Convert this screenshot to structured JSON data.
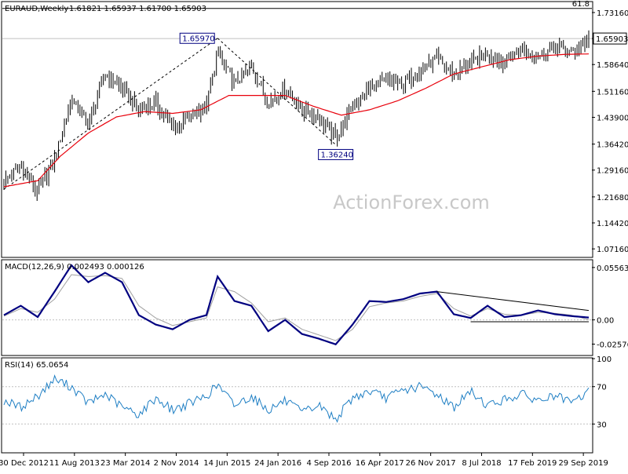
{
  "header": {
    "symbol": "EURAUD,Weekly",
    "ohlc": "1.61821 1.65937 1.61700 1.65903"
  },
  "watermark": "ActionForex.com",
  "colors": {
    "background": "#ffffff",
    "frame": "#000000",
    "grid": "#c0c0c0",
    "candle": "#000000",
    "ma": "#e8000b",
    "macd": "#000080",
    "signal": "#a0a0a0",
    "trend": "#000000",
    "rsi": "#1f7fc4",
    "price_box_bg": "#ffffff",
    "watermark": "#c8c8c8"
  },
  "chart_data": [
    {
      "type": "candlestick",
      "title": "EURAUD,Weekly",
      "ylim": [
        1.05,
        1.76
      ],
      "y_ticks": [
        "1.73160",
        "1.65903",
        "1.58640",
        "1.51160",
        "1.43900",
        "1.36420",
        "1.29160",
        "1.21680",
        "1.14420",
        "1.07160"
      ],
      "x_ticks": [
        "30 Dec 2012",
        "11 Aug 2013",
        "23 Mar 2014",
        "2 Nov 2014",
        "14 Jun 2015",
        "24 Jan 2016",
        "4 Sep 2016",
        "16 Apr 2017",
        "26 Nov 2017",
        "8 Jul 2018",
        "17 Feb 2019",
        "29 Sep 2019"
      ],
      "last_price": "1.65903",
      "fib_label": "61.8",
      "fib_level": 1.743,
      "annotations": [
        {
          "text": "1.65970",
          "date_index": 38,
          "value": 1.6597
        },
        {
          "text": "1.36240",
          "date_index": 59,
          "value": 1.3624
        }
      ],
      "dashed_lines": [
        {
          "from": [
            0,
            1.238
          ],
          "to": [
            38,
            1.6597
          ]
        },
        {
          "from": [
            38,
            1.6597
          ],
          "to": [
            59,
            1.3624
          ]
        }
      ],
      "close_points": [
        [
          0,
          1.26
        ],
        [
          3,
          1.3
        ],
        [
          6,
          1.23
        ],
        [
          9,
          1.32
        ],
        [
          12,
          1.49
        ],
        [
          15,
          1.42
        ],
        [
          18,
          1.56
        ],
        [
          21,
          1.52
        ],
        [
          24,
          1.46
        ],
        [
          27,
          1.48
        ],
        [
          30,
          1.41
        ],
        [
          33,
          1.44
        ],
        [
          36,
          1.47
        ],
        [
          38,
          1.62
        ],
        [
          41,
          1.53
        ],
        [
          44,
          1.58
        ],
        [
          47,
          1.48
        ],
        [
          50,
          1.52
        ],
        [
          53,
          1.46
        ],
        [
          56,
          1.44
        ],
        [
          59,
          1.38
        ],
        [
          62,
          1.47
        ],
        [
          65,
          1.52
        ],
        [
          68,
          1.54
        ],
        [
          71,
          1.53
        ],
        [
          74,
          1.57
        ],
        [
          77,
          1.6
        ],
        [
          80,
          1.56
        ],
        [
          83,
          1.59
        ],
        [
          86,
          1.62
        ],
        [
          89,
          1.59
        ],
        [
          92,
          1.63
        ],
        [
          95,
          1.61
        ],
        [
          98,
          1.64
        ],
        [
          101,
          1.62
        ],
        [
          104,
          1.659
        ]
      ],
      "ma_points": [
        [
          0,
          1.245
        ],
        [
          6,
          1.262
        ],
        [
          10,
          1.33
        ],
        [
          15,
          1.395
        ],
        [
          20,
          1.44
        ],
        [
          25,
          1.455
        ],
        [
          30,
          1.45
        ],
        [
          35,
          1.46
        ],
        [
          40,
          1.5
        ],
        [
          45,
          1.5
        ],
        [
          50,
          1.5
        ],
        [
          55,
          1.47
        ],
        [
          60,
          1.445
        ],
        [
          65,
          1.46
        ],
        [
          70,
          1.485
        ],
        [
          75,
          1.52
        ],
        [
          80,
          1.56
        ],
        [
          85,
          1.58
        ],
        [
          90,
          1.6
        ],
        [
          95,
          1.61
        ],
        [
          100,
          1.615
        ],
        [
          104,
          1.616
        ]
      ]
    },
    {
      "type": "line",
      "title": "MACD(12,26,9) 0.002493 0.000126",
      "ylim": [
        -0.037,
        0.063
      ],
      "y_ticks": [
        "0.055637",
        "0.00",
        "-0.02576"
      ],
      "series": [
        {
          "values": [
            [
              0,
              0.005
            ],
            [
              3,
              0.015
            ],
            [
              6,
              0.003
            ],
            [
              9,
              0.03
            ],
            [
              12,
              0.058
            ],
            [
              15,
              0.04
            ],
            [
              18,
              0.05
            ],
            [
              21,
              0.04
            ],
            [
              24,
              0.005
            ],
            [
              27,
              -0.005
            ],
            [
              30,
              -0.01
            ],
            [
              33,
              0.0
            ],
            [
              36,
              0.005
            ],
            [
              38,
              0.046
            ],
            [
              41,
              0.02
            ],
            [
              44,
              0.015
            ],
            [
              47,
              -0.012
            ],
            [
              50,
              0.0
            ],
            [
              53,
              -0.015
            ],
            [
              56,
              -0.02
            ],
            [
              59,
              -0.026
            ],
            [
              62,
              -0.005
            ],
            [
              65,
              0.02
            ],
            [
              68,
              0.019
            ],
            [
              71,
              0.022
            ],
            [
              74,
              0.028
            ],
            [
              77,
              0.03
            ],
            [
              80,
              0.006
            ],
            [
              83,
              0.002
            ],
            [
              86,
              0.015
            ],
            [
              89,
              0.003
            ],
            [
              92,
              0.005
            ],
            [
              95,
              0.01
            ],
            [
              98,
              0.006
            ],
            [
              101,
              0.004
            ],
            [
              104,
              0.0025
            ]
          ]
        },
        {
          "values": [
            [
              0,
              0.004
            ],
            [
              3,
              0.012
            ],
            [
              6,
              0.008
            ],
            [
              9,
              0.022
            ],
            [
              12,
              0.048
            ],
            [
              15,
              0.046
            ],
            [
              18,
              0.047
            ],
            [
              21,
              0.044
            ],
            [
              24,
              0.015
            ],
            [
              27,
              0.002
            ],
            [
              30,
              -0.006
            ],
            [
              33,
              -0.002
            ],
            [
              36,
              0.002
            ],
            [
              38,
              0.035
            ],
            [
              41,
              0.03
            ],
            [
              44,
              0.018
            ],
            [
              47,
              -0.002
            ],
            [
              50,
              0.002
            ],
            [
              53,
              -0.01
            ],
            [
              56,
              -0.016
            ],
            [
              59,
              -0.022
            ],
            [
              62,
              -0.01
            ],
            [
              65,
              0.014
            ],
            [
              68,
              0.018
            ],
            [
              71,
              0.02
            ],
            [
              74,
              0.025
            ],
            [
              77,
              0.028
            ],
            [
              80,
              0.012
            ],
            [
              83,
              0.004
            ],
            [
              86,
              0.012
            ],
            [
              89,
              0.006
            ],
            [
              92,
              0.005
            ],
            [
              95,
              0.008
            ],
            [
              98,
              0.007
            ],
            [
              101,
              0.005
            ],
            [
              104,
              0.000126
            ]
          ]
        }
      ],
      "trendlines": [
        {
          "from": [
            77,
            0.03
          ],
          "to": [
            104,
            0.01
          ]
        },
        {
          "from": [
            83,
            -0.002
          ],
          "to": [
            104,
            -0.002
          ]
        }
      ]
    },
    {
      "type": "line",
      "title": "RSI(14) 65.0654",
      "ylim": [
        0,
        100
      ],
      "y_ticks": [
        "100",
        "70",
        "30",
        "0"
      ],
      "levels": [
        70,
        30
      ],
      "series": [
        {
          "values": [
            [
              0,
              55
            ],
            [
              3,
              48
            ],
            [
              6,
              60
            ],
            [
              9,
              78
            ],
            [
              12,
              70
            ],
            [
              15,
              52
            ],
            [
              18,
              62
            ],
            [
              21,
              48
            ],
            [
              24,
              40
            ],
            [
              27,
              58
            ],
            [
              30,
              45
            ],
            [
              33,
              52
            ],
            [
              36,
              60
            ],
            [
              38,
              72
            ],
            [
              41,
              50
            ],
            [
              44,
              60
            ],
            [
              47,
              45
            ],
            [
              50,
              55
            ],
            [
              53,
              42
            ],
            [
              56,
              50
            ],
            [
              59,
              35
            ],
            [
              62,
              58
            ],
            [
              65,
              65
            ],
            [
              68,
              58
            ],
            [
              71,
              66
            ],
            [
              74,
              70
            ],
            [
              77,
              62
            ],
            [
              80,
              48
            ],
            [
              83,
              65
            ],
            [
              86,
              50
            ],
            [
              89,
              56
            ],
            [
              92,
              62
            ],
            [
              95,
              55
            ],
            [
              98,
              60
            ],
            [
              101,
              52
            ],
            [
              104,
              65
            ]
          ]
        }
      ]
    }
  ]
}
